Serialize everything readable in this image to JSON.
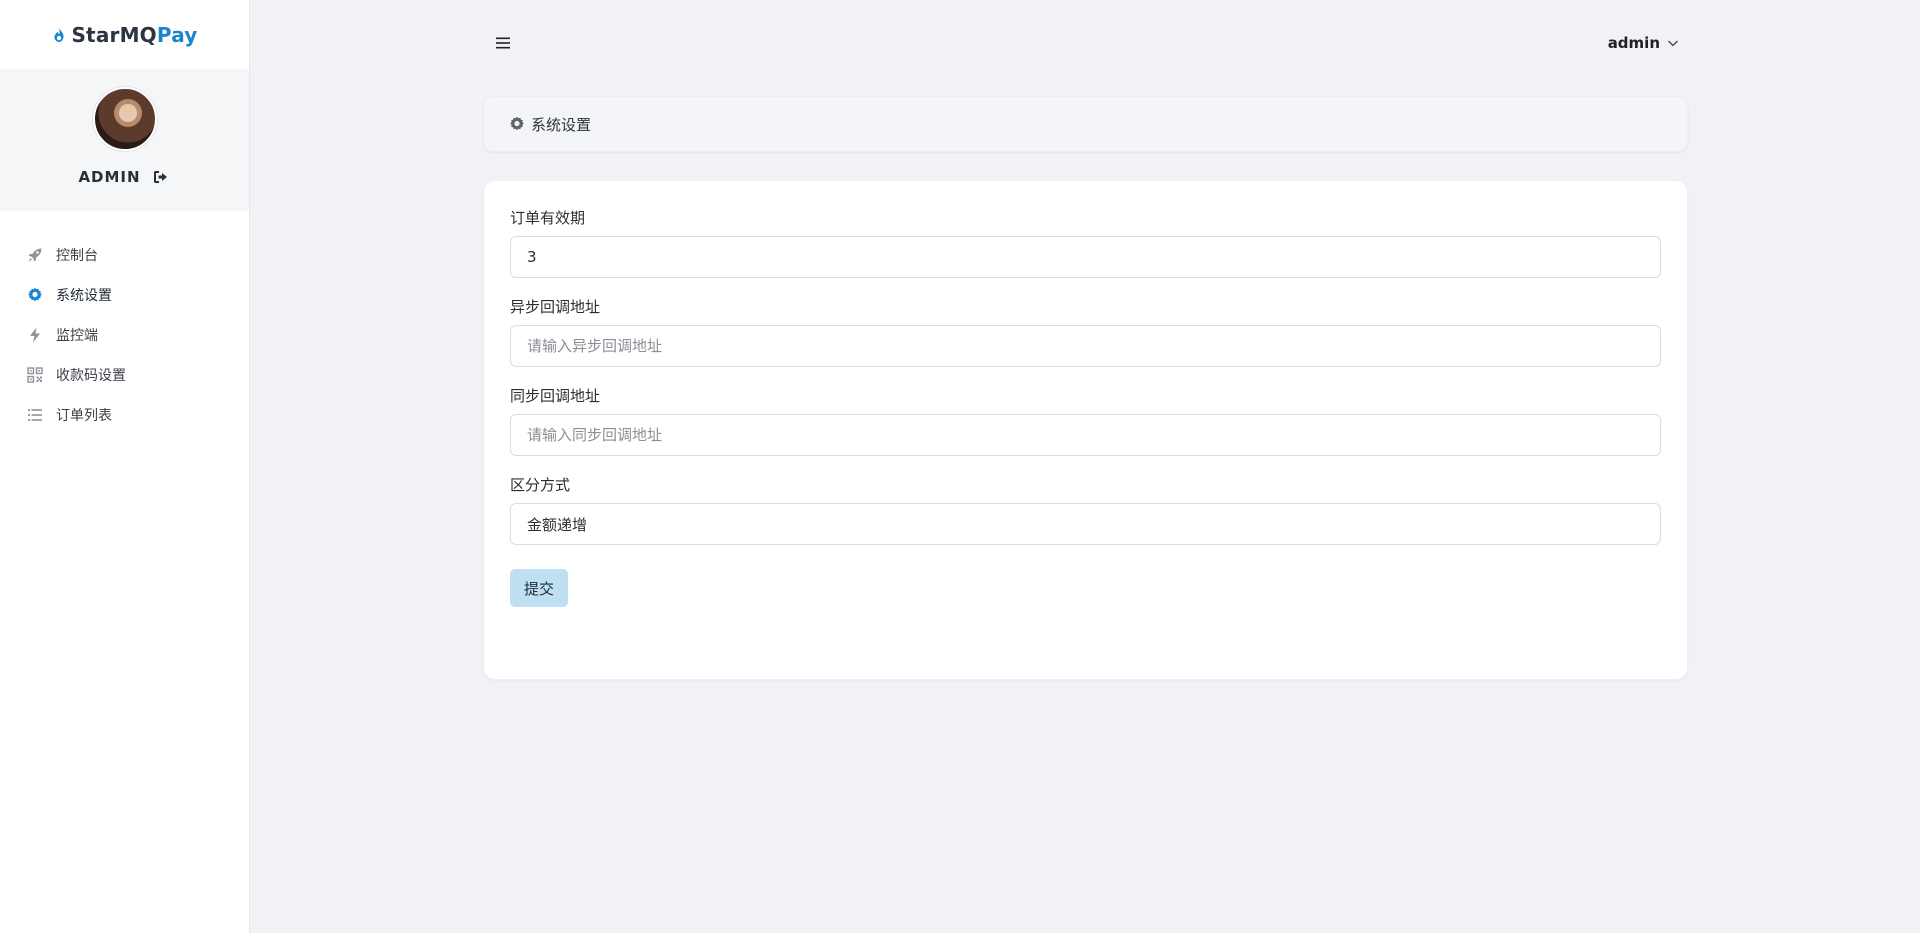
{
  "brand": {
    "star": "StarMQ",
    "pay": "Pay"
  },
  "profile": {
    "name": "ADMIN"
  },
  "sidebar": {
    "items": [
      {
        "label": "控制台",
        "icon": "rocket-icon"
      },
      {
        "label": "系统设置",
        "icon": "gear-icon",
        "active": true
      },
      {
        "label": "监控端",
        "icon": "bolt-icon"
      },
      {
        "label": "收款码设置",
        "icon": "qrcode-icon"
      },
      {
        "label": "订单列表",
        "icon": "list-icon"
      }
    ]
  },
  "topbar": {
    "user": "admin"
  },
  "breadcrumb": {
    "title": "系统设置"
  },
  "form": {
    "order_validity": {
      "label": "订单有效期",
      "value": "3"
    },
    "async_callback": {
      "label": "异步回调地址",
      "value": "",
      "placeholder": "请输入异步回调地址"
    },
    "sync_callback": {
      "label": "同步回调地址",
      "value": "",
      "placeholder": "请输入同步回调地址"
    },
    "distinguish_mode": {
      "label": "区分方式",
      "value": "金额递增"
    },
    "submit_label": "提交"
  },
  "colors": {
    "accent": "#1a86cf",
    "page_bg": "#f1f2f6",
    "submit_bg": "#bfe0f2"
  }
}
